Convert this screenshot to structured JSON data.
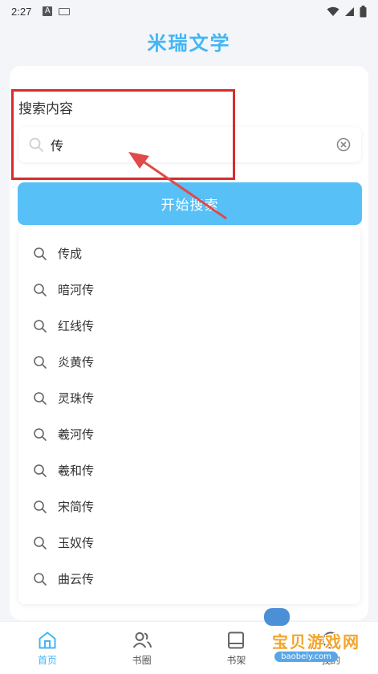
{
  "status_bar": {
    "time": "2:27",
    "left_icons": [
      "a-notification-icon",
      "keyboard-icon"
    ],
    "right_icons": [
      "wifi-icon",
      "signal-icon",
      "battery-icon"
    ]
  },
  "app": {
    "title": "米瑞文学"
  },
  "search": {
    "section_label": "搜索内容",
    "input_value": "传",
    "button_label": "开始搜索"
  },
  "suggestions": [
    "传成",
    "暗河传",
    "红线传",
    "炎黄传",
    "灵珠传",
    "羲河传",
    "羲和传",
    "宋简传",
    "玉奴传",
    "曲云传"
  ],
  "tabs": [
    {
      "label": "首页",
      "icon": "home-icon",
      "active": true
    },
    {
      "label": "书圈",
      "icon": "people-icon",
      "active": false
    },
    {
      "label": "书架",
      "icon": "bookshelf-icon",
      "active": false
    },
    {
      "label": "我的",
      "icon": "profile-icon",
      "active": false
    }
  ],
  "watermark": {
    "title": "宝贝游戏网",
    "url": "baobeiy.com"
  },
  "colors": {
    "accent": "#43b6f4",
    "button": "#56c0f7",
    "highlight_border": "#d62d2d",
    "background": "#f3f5f9"
  }
}
